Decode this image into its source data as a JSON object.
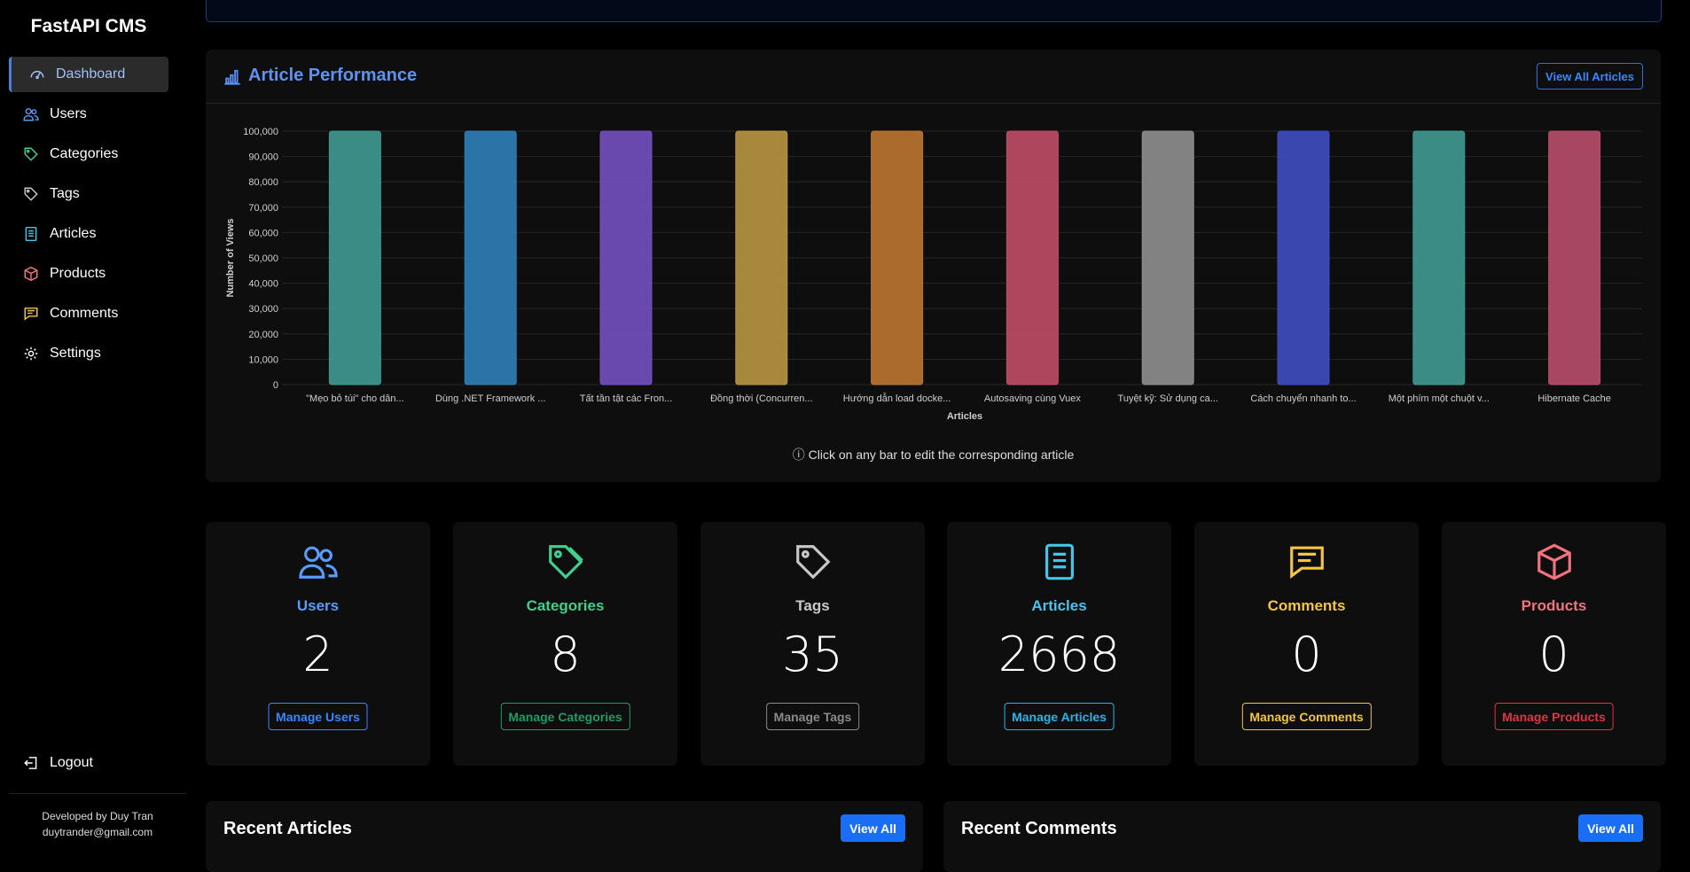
{
  "app": {
    "title": "FastAPI CMS"
  },
  "sidebar": {
    "items": [
      {
        "label": "Dashboard",
        "icon": "speedometer-icon",
        "active": true
      },
      {
        "label": "Users",
        "icon": "users-icon"
      },
      {
        "label": "Categories",
        "icon": "tag-icon"
      },
      {
        "label": "Tags",
        "icon": "tags-icon"
      },
      {
        "label": "Articles",
        "icon": "document-icon"
      },
      {
        "label": "Products",
        "icon": "box-icon"
      },
      {
        "label": "Comments",
        "icon": "chat-icon"
      },
      {
        "label": "Settings",
        "icon": "gear-icon"
      }
    ],
    "logout_label": "Logout",
    "credit_line1": "Developed by Duy Tran",
    "credit_line2": "duytrander@gmail.com"
  },
  "performance": {
    "title": "Article Performance",
    "view_all_label": "View All Articles",
    "hint": "Click on any bar to edit the corresponding article"
  },
  "chart_data": {
    "type": "bar",
    "categories": [
      "\"Mẹo bỏ túi\" cho dân...",
      "Dùng .NET Framework ...",
      "Tất tần tật các Fron...",
      "Đồng thời (Concurren...",
      "Hướng dẫn load docke...",
      "Autosaving cùng Vuex",
      "Tuyệt kỹ: Sử dụng ca...",
      "Cách chuyển nhanh to...",
      "Một phím một chuột v...",
      "Hibernate Cache"
    ],
    "values": [
      100000,
      100000,
      100000,
      100000,
      100000,
      100000,
      100000,
      100000,
      100000,
      100000
    ],
    "colors": [
      "#3f9a92",
      "#2e7fb8",
      "#7450c0",
      "#b99642",
      "#bc7630",
      "#c04e66",
      "#8f8f8f",
      "#3f4ec0",
      "#3f9a92",
      "#b84e6c"
    ],
    "xlabel": "Articles",
    "ylabel": "Number of Views",
    "ylim": [
      0,
      100000
    ],
    "yticks": [
      0,
      10000,
      20000,
      30000,
      40000,
      50000,
      60000,
      70000,
      80000,
      90000,
      100000
    ],
    "ytick_labels": [
      "0",
      "10,000",
      "20,000",
      "30,000",
      "40,000",
      "50,000",
      "60,000",
      "70,000",
      "80,000",
      "90,000",
      "100,000"
    ],
    "grid": true,
    "legend": "none"
  },
  "stats": [
    {
      "label": "Users",
      "value": "2",
      "button": "Manage Users",
      "color": "#5b9bf8",
      "btn_color": "#3b86ff",
      "icon": "users-icon"
    },
    {
      "label": "Categories",
      "value": "8",
      "button": "Manage Categories",
      "color": "#3fcf8e",
      "btn_color": "#1f9d63",
      "icon": "tag-icon"
    },
    {
      "label": "Tags",
      "value": "35",
      "button": "Manage Tags",
      "color": "#c8c8c8",
      "btn_color": "#8a8a8a",
      "icon": "tags-icon"
    },
    {
      "label": "Articles",
      "value": "2668",
      "button": "Manage Articles",
      "color": "#45c4ee",
      "btn_color": "#2ab3e6",
      "icon": "document-icon"
    },
    {
      "label": "Comments",
      "value": "0",
      "button": "Manage Comments",
      "color": "#f4c542",
      "btn_color": "#f4c542",
      "icon": "chat-icon"
    },
    {
      "label": "Products",
      "value": "0",
      "button": "Manage Products",
      "color": "#f0737f",
      "btn_color": "#dc3545",
      "icon": "box-icon"
    }
  ],
  "recent_articles": {
    "title": "Recent Articles",
    "view_all_label": "View All"
  },
  "recent_comments": {
    "title": "Recent Comments",
    "view_all_label": "View All"
  }
}
